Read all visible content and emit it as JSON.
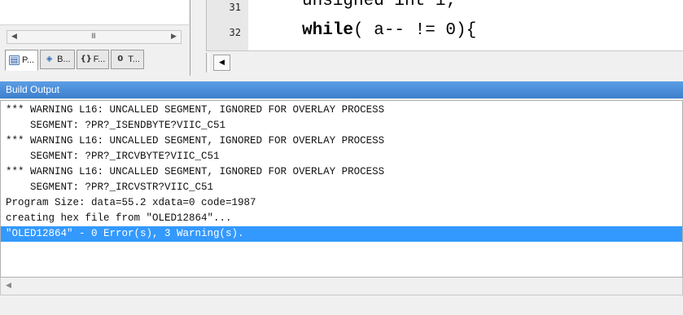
{
  "project_panel": {
    "tabs": [
      {
        "label": "P...",
        "icon": "project-icon"
      },
      {
        "label": "B...",
        "icon": "books-icon"
      },
      {
        "label": "F...",
        "icon": "functions-icon"
      },
      {
        "label": "T...",
        "icon": "templates-icon"
      }
    ],
    "scroll_grip": "III"
  },
  "editor": {
    "lines": [
      {
        "number": "31",
        "code": "unsigned int i;"
      },
      {
        "number": "32",
        "code_keyword": "while",
        "code_rest": "( a-- != 0){"
      }
    ]
  },
  "build_output": {
    "title": "Build Output",
    "lines": [
      "*** WARNING L16: UNCALLED SEGMENT, IGNORED FOR OVERLAY PROCESS",
      "    SEGMENT: ?PR?_ISENDBYTE?VIIC_C51",
      "*** WARNING L16: UNCALLED SEGMENT, IGNORED FOR OVERLAY PROCESS",
      "    SEGMENT: ?PR?_IRCVBYTE?VIIC_C51",
      "*** WARNING L16: UNCALLED SEGMENT, IGNORED FOR OVERLAY PROCESS",
      "    SEGMENT: ?PR?_IRCVSTR?VIIC_C51",
      "Program Size: data=55.2 xdata=0 code=1987",
      "creating hex file from \"OLED12864\"...",
      "\"OLED12864\" - 0 Error(s), 3 Warning(s)."
    ],
    "selected_index": 8
  },
  "colors": {
    "title_bar": "#4a8fd8",
    "selection": "#3399ff"
  }
}
